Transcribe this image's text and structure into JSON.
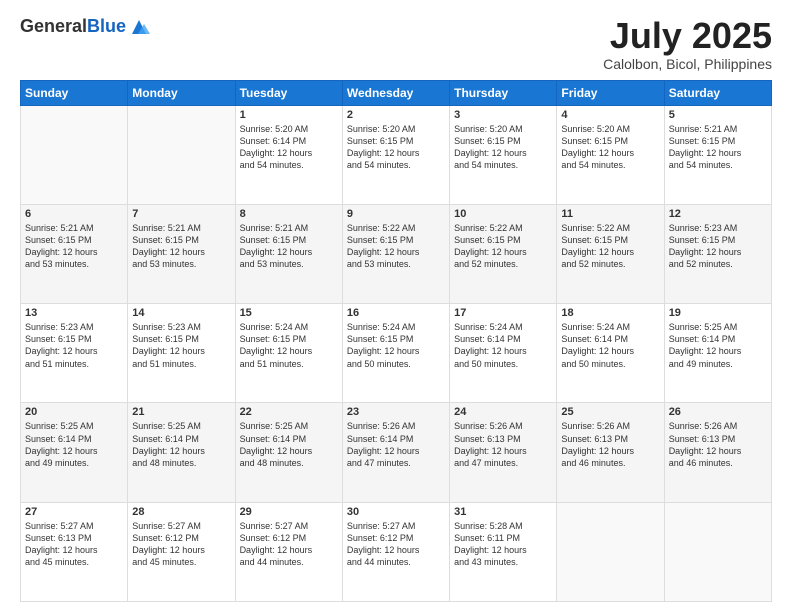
{
  "header": {
    "logo_general": "General",
    "logo_blue": "Blue",
    "month_title": "July 2025",
    "location": "Calolbon, Bicol, Philippines"
  },
  "days_of_week": [
    "Sunday",
    "Monday",
    "Tuesday",
    "Wednesday",
    "Thursday",
    "Friday",
    "Saturday"
  ],
  "weeks": [
    [
      {
        "day": "",
        "info": ""
      },
      {
        "day": "",
        "info": ""
      },
      {
        "day": "1",
        "sunrise": "5:20 AM",
        "sunset": "6:14 PM",
        "daylight": "12 hours and 54 minutes."
      },
      {
        "day": "2",
        "sunrise": "5:20 AM",
        "sunset": "6:15 PM",
        "daylight": "12 hours and 54 minutes."
      },
      {
        "day": "3",
        "sunrise": "5:20 AM",
        "sunset": "6:15 PM",
        "daylight": "12 hours and 54 minutes."
      },
      {
        "day": "4",
        "sunrise": "5:20 AM",
        "sunset": "6:15 PM",
        "daylight": "12 hours and 54 minutes."
      },
      {
        "day": "5",
        "sunrise": "5:21 AM",
        "sunset": "6:15 PM",
        "daylight": "12 hours and 54 minutes."
      }
    ],
    [
      {
        "day": "6",
        "sunrise": "5:21 AM",
        "sunset": "6:15 PM",
        "daylight": "12 hours and 53 minutes."
      },
      {
        "day": "7",
        "sunrise": "5:21 AM",
        "sunset": "6:15 PM",
        "daylight": "12 hours and 53 minutes."
      },
      {
        "day": "8",
        "sunrise": "5:21 AM",
        "sunset": "6:15 PM",
        "daylight": "12 hours and 53 minutes."
      },
      {
        "day": "9",
        "sunrise": "5:22 AM",
        "sunset": "6:15 PM",
        "daylight": "12 hours and 53 minutes."
      },
      {
        "day": "10",
        "sunrise": "5:22 AM",
        "sunset": "6:15 PM",
        "daylight": "12 hours and 52 minutes."
      },
      {
        "day": "11",
        "sunrise": "5:22 AM",
        "sunset": "6:15 PM",
        "daylight": "12 hours and 52 minutes."
      },
      {
        "day": "12",
        "sunrise": "5:23 AM",
        "sunset": "6:15 PM",
        "daylight": "12 hours and 52 minutes."
      }
    ],
    [
      {
        "day": "13",
        "sunrise": "5:23 AM",
        "sunset": "6:15 PM",
        "daylight": "12 hours and 51 minutes."
      },
      {
        "day": "14",
        "sunrise": "5:23 AM",
        "sunset": "6:15 PM",
        "daylight": "12 hours and 51 minutes."
      },
      {
        "day": "15",
        "sunrise": "5:24 AM",
        "sunset": "6:15 PM",
        "daylight": "12 hours and 51 minutes."
      },
      {
        "day": "16",
        "sunrise": "5:24 AM",
        "sunset": "6:15 PM",
        "daylight": "12 hours and 50 minutes."
      },
      {
        "day": "17",
        "sunrise": "5:24 AM",
        "sunset": "6:14 PM",
        "daylight": "12 hours and 50 minutes."
      },
      {
        "day": "18",
        "sunrise": "5:24 AM",
        "sunset": "6:14 PM",
        "daylight": "12 hours and 50 minutes."
      },
      {
        "day": "19",
        "sunrise": "5:25 AM",
        "sunset": "6:14 PM",
        "daylight": "12 hours and 49 minutes."
      }
    ],
    [
      {
        "day": "20",
        "sunrise": "5:25 AM",
        "sunset": "6:14 PM",
        "daylight": "12 hours and 49 minutes."
      },
      {
        "day": "21",
        "sunrise": "5:25 AM",
        "sunset": "6:14 PM",
        "daylight": "12 hours and 48 minutes."
      },
      {
        "day": "22",
        "sunrise": "5:25 AM",
        "sunset": "6:14 PM",
        "daylight": "12 hours and 48 minutes."
      },
      {
        "day": "23",
        "sunrise": "5:26 AM",
        "sunset": "6:14 PM",
        "daylight": "12 hours and 47 minutes."
      },
      {
        "day": "24",
        "sunrise": "5:26 AM",
        "sunset": "6:13 PM",
        "daylight": "12 hours and 47 minutes."
      },
      {
        "day": "25",
        "sunrise": "5:26 AM",
        "sunset": "6:13 PM",
        "daylight": "12 hours and 46 minutes."
      },
      {
        "day": "26",
        "sunrise": "5:26 AM",
        "sunset": "6:13 PM",
        "daylight": "12 hours and 46 minutes."
      }
    ],
    [
      {
        "day": "27",
        "sunrise": "5:27 AM",
        "sunset": "6:13 PM",
        "daylight": "12 hours and 45 minutes."
      },
      {
        "day": "28",
        "sunrise": "5:27 AM",
        "sunset": "6:12 PM",
        "daylight": "12 hours and 45 minutes."
      },
      {
        "day": "29",
        "sunrise": "5:27 AM",
        "sunset": "6:12 PM",
        "daylight": "12 hours and 44 minutes."
      },
      {
        "day": "30",
        "sunrise": "5:27 AM",
        "sunset": "6:12 PM",
        "daylight": "12 hours and 44 minutes."
      },
      {
        "day": "31",
        "sunrise": "5:28 AM",
        "sunset": "6:11 PM",
        "daylight": "12 hours and 43 minutes."
      },
      {
        "day": "",
        "info": ""
      },
      {
        "day": "",
        "info": ""
      }
    ]
  ],
  "labels": {
    "sunrise_prefix": "Sunrise: ",
    "sunset_prefix": "Sunset: ",
    "daylight_prefix": "Daylight: "
  }
}
